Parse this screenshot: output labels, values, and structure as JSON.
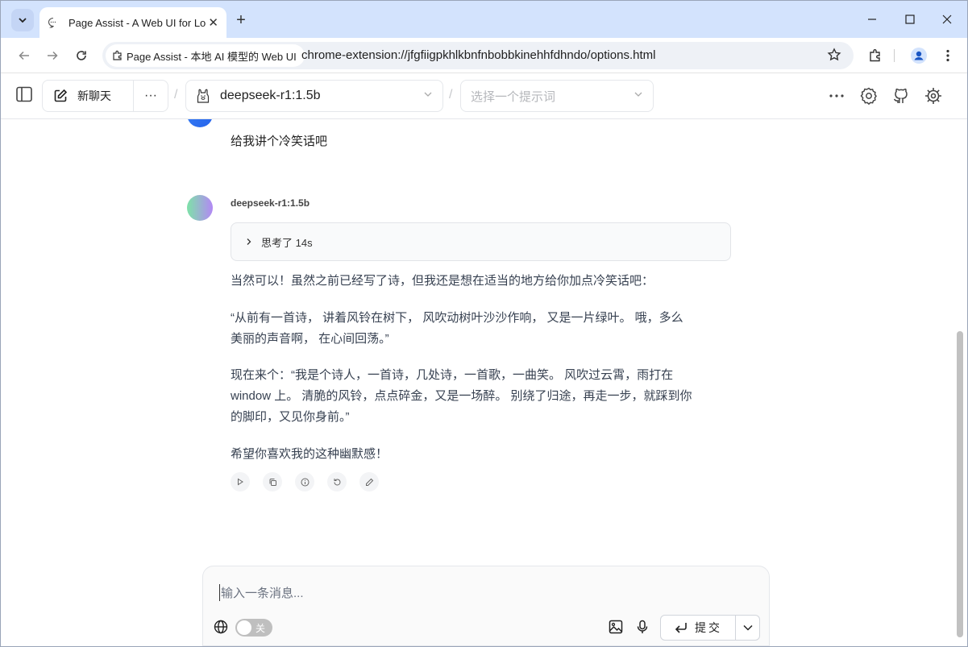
{
  "browser": {
    "tab_title": "Page Assist - A Web UI for Lo",
    "chip_label": "Page Assist - 本地 AI 模型的 Web UI",
    "url": "chrome-extension://jfgfiigpkhlkbnfnbobbkinehhfdhndo/options.html"
  },
  "header": {
    "new_chat_label": "新聊天",
    "more_label": "···",
    "model_name": "deepseek-r1:1.5b",
    "prompt_placeholder": "选择一个提示词",
    "sep": "/"
  },
  "chat": {
    "user_message": "给我讲个冷笑话吧",
    "bot_name": "deepseek-r1:1.5b",
    "think_label": "思考了 14s",
    "paragraphs": [
      "当然可以！虽然之前已经写了诗，但我还是想在适当的地方给你加点冷笑话吧：",
      "“从前有一首诗， 讲着风铃在树下， 风吹动树叶沙沙作响， 又是一片绿叶。 哦，多么美丽的声音啊， 在心间回荡。”",
      "现在来个：“我是个诗人，一首诗，几处诗，一首歌，一曲笑。 风吹过云霄，雨打在 window 上。 清脆的风铃，点点碎金，又是一场醉。 别绕了归途，再走一步，就踩到你的脚印，又见你身前。”",
      "希望你喜欢我的这种幽默感！"
    ]
  },
  "composer": {
    "placeholder": "输入一条消息...",
    "toggle_label": "关",
    "submit_label": "提交"
  }
}
